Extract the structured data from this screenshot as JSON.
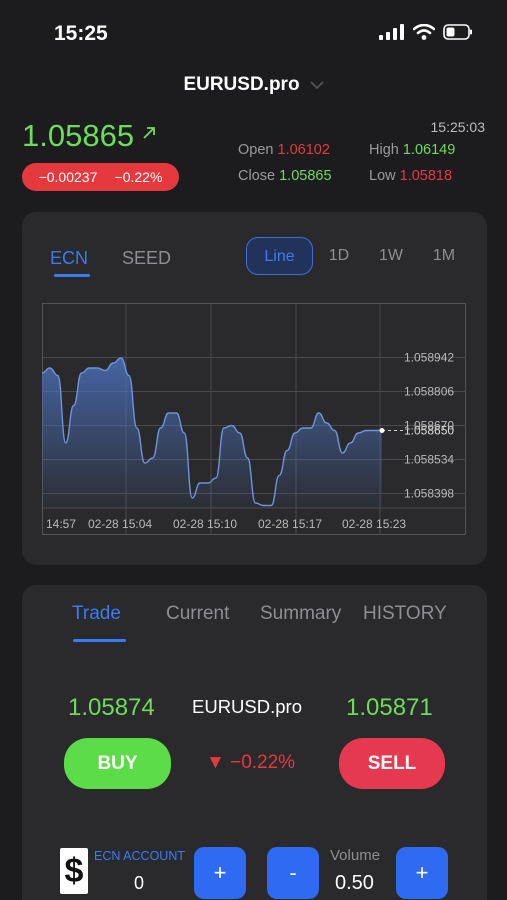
{
  "status": {
    "time": "15:25"
  },
  "symbol": "EURUSD.pro",
  "quote": {
    "price": "1.05865",
    "change": "−0.00237",
    "change_pct": "−0.22%",
    "time": "15:25:03",
    "open_label": "Open",
    "open": "1.06102",
    "high_label": "High",
    "high": "1.06149",
    "close_label": "Close",
    "close": "1.05865",
    "low_label": "Low",
    "low": "1.05818"
  },
  "chart_tabs": {
    "ecn": "ECN",
    "seed": "SEED"
  },
  "ranges": [
    "Line",
    "1D",
    "1W",
    "1M"
  ],
  "chart_data": {
    "type": "area",
    "title": "",
    "xlabel": "",
    "ylabel": "",
    "x_ticks": [
      "14:57",
      "02-28 15:04",
      "02-28 15:10",
      "02-28 15:17",
      "02-28 15:23"
    ],
    "y_ticks": [
      "1.058942",
      "1.058806",
      "1.058670",
      "1.058534",
      "1.058398"
    ],
    "current_label": "1.058650",
    "ylim": [
      1.05834,
      1.05916
    ],
    "grid": true,
    "series": [
      {
        "values": [
          1.05888,
          1.0589,
          1.05887,
          1.0586,
          1.05875,
          1.05888,
          1.0589,
          1.0589,
          1.05889,
          1.05892,
          1.05894,
          1.05887,
          1.05866,
          1.05852,
          1.05854,
          1.05866,
          1.05872,
          1.05872,
          1.05864,
          1.05838,
          1.05844,
          1.05844,
          1.05846,
          1.05866,
          1.05867,
          1.05864,
          1.05854,
          1.05836,
          1.05835,
          1.05835,
          1.05847,
          1.05857,
          1.05864,
          1.05866,
          1.05866,
          1.05872,
          1.05868,
          1.05865,
          1.05856,
          1.0586,
          1.05864,
          1.05865,
          1.05865,
          1.05865
        ]
      }
    ]
  },
  "trade_tabs": [
    "Trade",
    "Current",
    "Summary",
    "HISTORY"
  ],
  "trade": {
    "bid": "1.05874",
    "ask": "1.05871",
    "buy_label": "BUY",
    "sell_label": "SELL",
    "change_pct": "−0.22%",
    "account_label": "ECN ACCOUNT",
    "account_value": "0",
    "volume_label": "Volume",
    "volume_value": "0.50",
    "plus": "+",
    "minus": "-",
    "dollar": "$",
    "down_arrow": "▼"
  },
  "colors": {
    "up": "#6ddc5a",
    "down": "#e5393e",
    "accent": "#3a7bf7",
    "card": "#2a2a2c",
    "bg": "#1c1c1e"
  }
}
